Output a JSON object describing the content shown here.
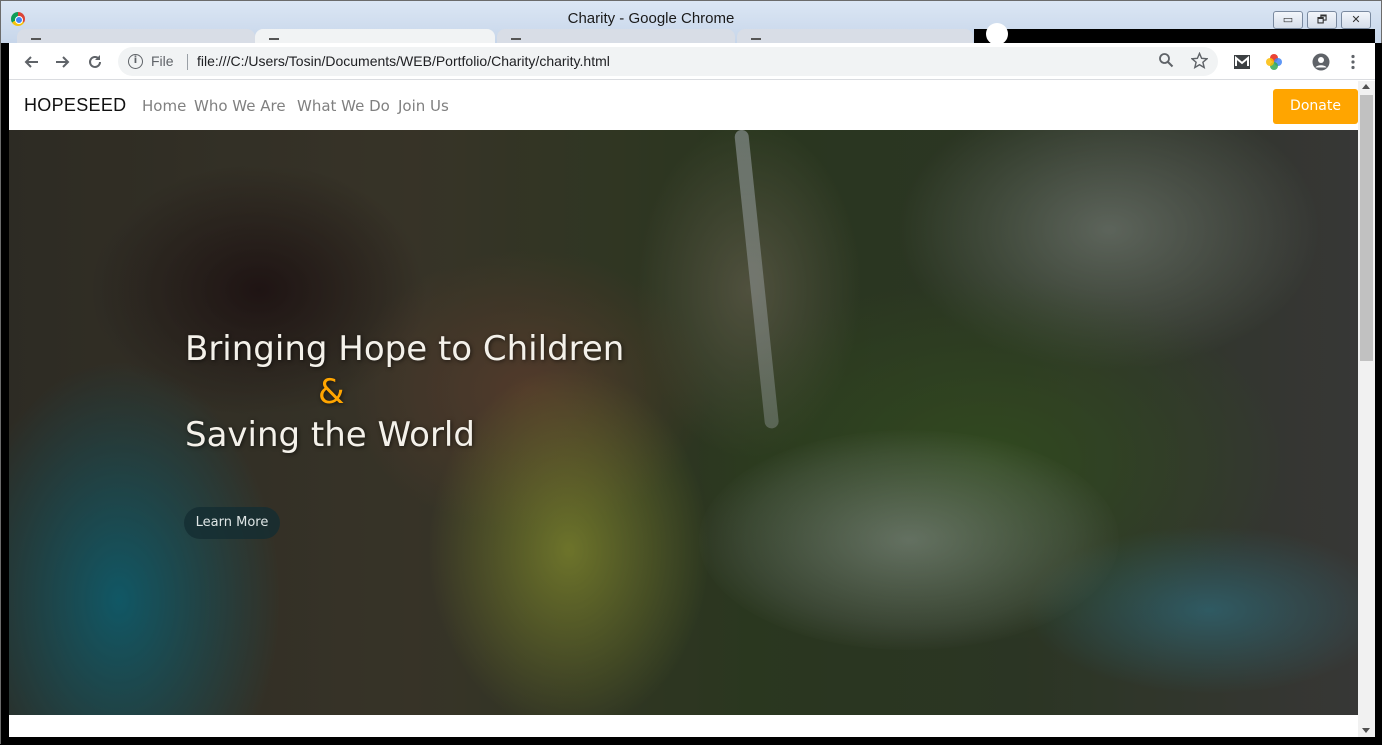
{
  "window": {
    "title": "Charity - Google Chrome",
    "controls": {
      "minimize": "▭",
      "restore": "🗗",
      "close": "✕"
    }
  },
  "browser": {
    "omnibox": {
      "scheme_label": "File",
      "url": "file:///C:/Users/Tosin/Documents/WEB/Portfolio/Charity/charity.html"
    },
    "icons": [
      "back-icon",
      "forward-icon",
      "reload-icon",
      "info-icon",
      "zoom-icon",
      "star-icon",
      "gmail-extension-icon",
      "color-extension-icon",
      "account-icon",
      "menu-icon"
    ]
  },
  "site": {
    "brand": "HOPESEED",
    "nav": [
      "Home",
      "Who We Are",
      "What We Do",
      "Join Us"
    ],
    "donate_label": "Donate",
    "hero": {
      "line1": "Bringing Hope to Children",
      "amp": "&",
      "line2": "Saving the World",
      "cta": "Learn More"
    },
    "colors": {
      "accent": "#ffa500",
      "nav_text": "#808080"
    }
  }
}
